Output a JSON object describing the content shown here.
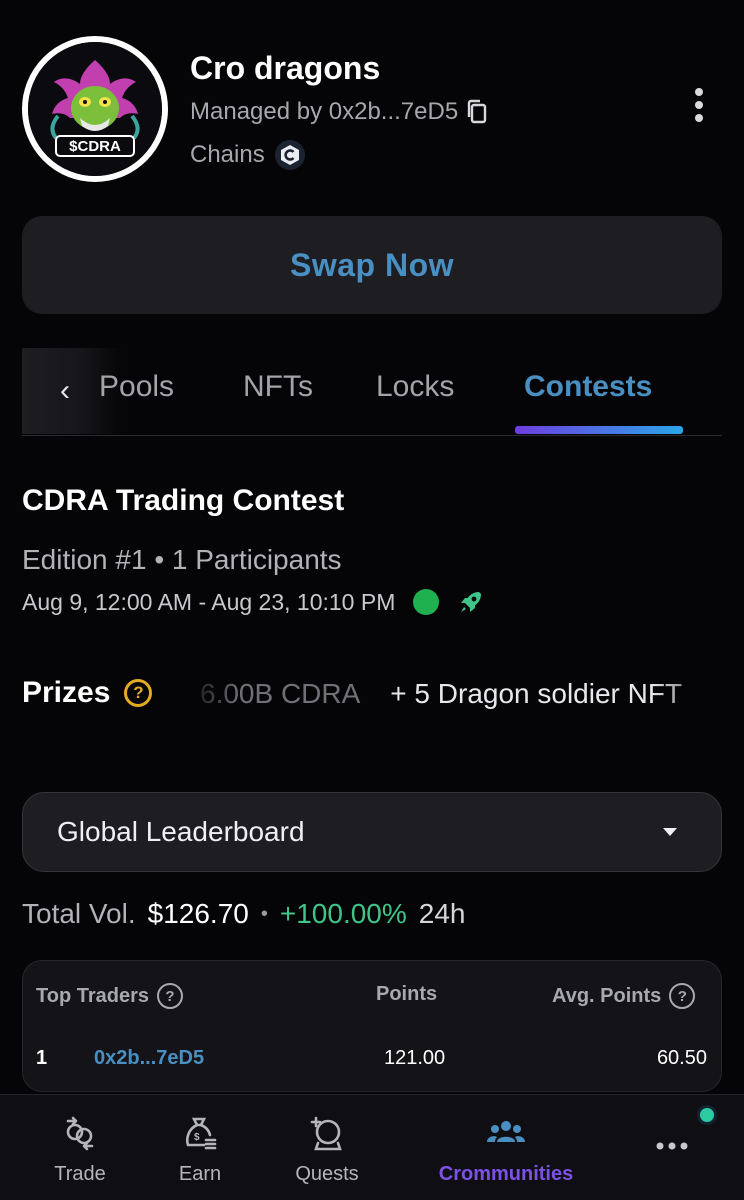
{
  "header": {
    "title": "Cro dragons",
    "managed_by": "Managed by 0x2b...7eD5",
    "chains_label": "Chains",
    "avatar_text": "$CDRA"
  },
  "swap_button": "Swap Now",
  "tabs": {
    "items": [
      "Pools",
      "NFTs",
      "Locks",
      "Contests"
    ],
    "active": "Contests"
  },
  "contest": {
    "title": "CDRA Trading Contest",
    "edition": "Edition #1 • 1 Participants",
    "dates": "Aug 9, 12:00 AM - Aug 23, 10:10 PM",
    "prizes_label": "Prizes",
    "prizes": [
      "6.00B CDRA",
      "+ 5 Dragon soldier NFT"
    ]
  },
  "leaderboard": {
    "select_value": "Global Leaderboard",
    "total_vol_label": "Total Vol.",
    "total_vol_value": "$126.70",
    "change": "+100.00%",
    "period": "24h",
    "columns": [
      "Top Traders",
      "Points",
      "Avg. Points"
    ],
    "rows": [
      {
        "rank": "1",
        "trader": "0x2b...7eD5",
        "points": "121.00",
        "avg_points": "60.50"
      }
    ]
  },
  "nav": {
    "items": [
      "Trade",
      "Earn",
      "Quests",
      "Crommunities"
    ],
    "active": "Crommunities"
  },
  "colors": {
    "accent_blue": "#4a8fc2",
    "accent_purple": "#7c52e6",
    "positive_green": "#3fc48a",
    "status_green": "#1fb150",
    "help_yellow": "#e3ab22"
  }
}
